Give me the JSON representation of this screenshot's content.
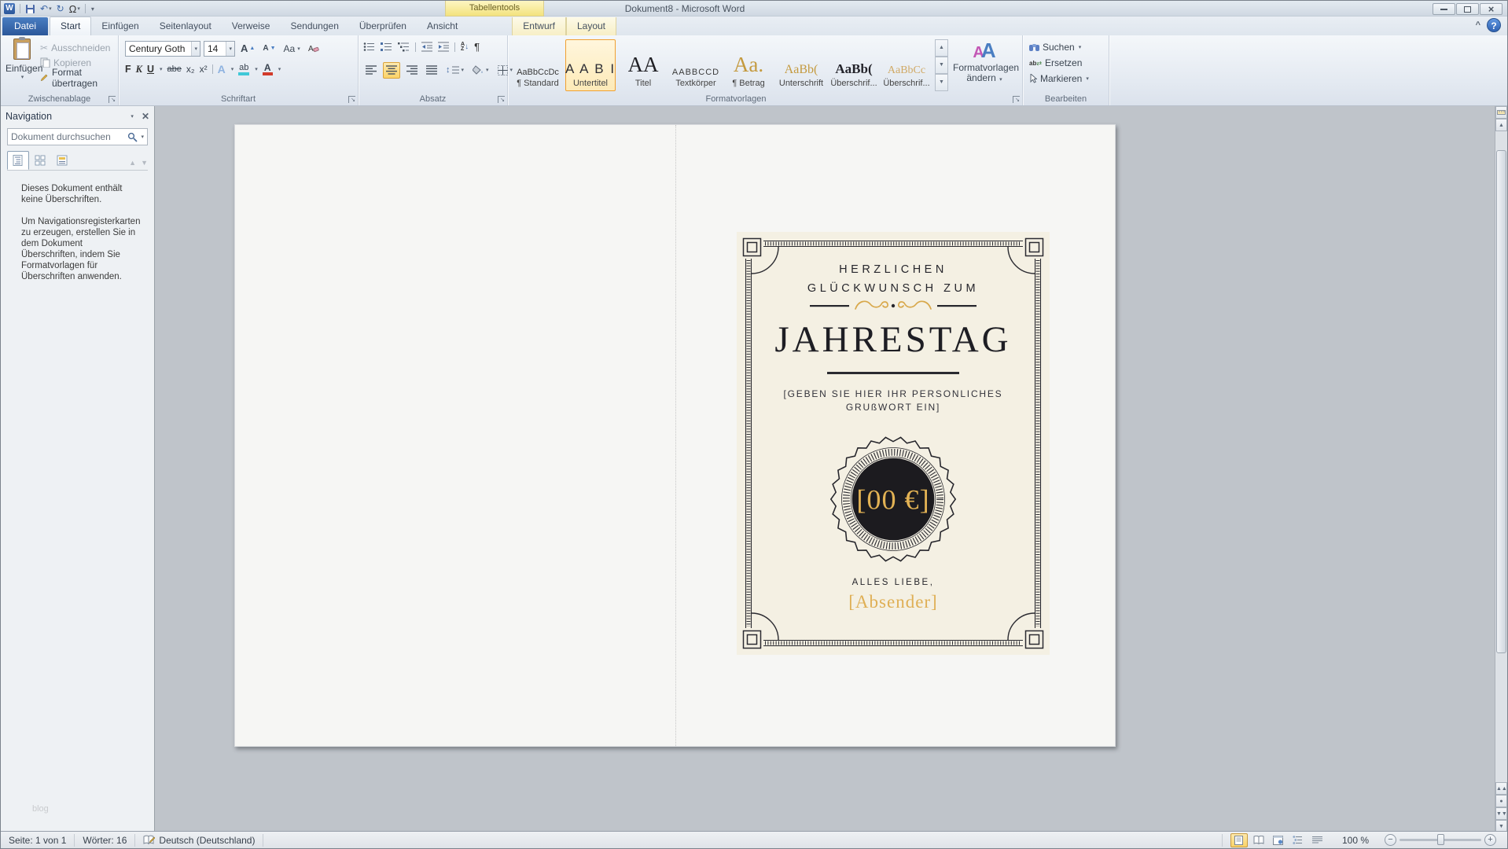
{
  "window": {
    "title": "Dokument8 - Microsoft Word",
    "contextual_tool": "Tabellentools"
  },
  "tabs": {
    "file": "Datei",
    "items": [
      "Start",
      "Einfügen",
      "Seitenlayout",
      "Verweise",
      "Sendungen",
      "Überprüfen",
      "Ansicht"
    ],
    "contextual": [
      "Entwurf",
      "Layout"
    ]
  },
  "ribbon": {
    "clipboard": {
      "label": "Zwischenablage",
      "paste": "Einfügen",
      "cut": "Ausschneiden",
      "copy": "Kopieren",
      "format_painter": "Format übertragen"
    },
    "font": {
      "label": "Schriftart",
      "name": "Century Goth",
      "size": "14",
      "bold": "F",
      "italic": "K",
      "underline": "U",
      "strike": "abe",
      "subscript": "x₂",
      "superscript": "x²",
      "case": "Aa",
      "effects": "A",
      "highlight": "ab",
      "color": "A"
    },
    "paragraph": {
      "label": "Absatz",
      "sort_a": "A",
      "sort_z": "Z",
      "pilcrow": "¶"
    },
    "styles": {
      "label": "Formatvorlagen",
      "change_line1": "Formatvorlagen",
      "change_line2": "ändern",
      "items": [
        {
          "preview": "AaBbCcDc",
          "label": "¶ Standard"
        },
        {
          "preview": "A A B I",
          "label": "Untertitel"
        },
        {
          "preview": "AA",
          "label": "Titel"
        },
        {
          "preview": "AABBCCD",
          "label": "Textkörper"
        },
        {
          "preview": "Aa.",
          "label": "¶ Betrag"
        },
        {
          "preview": "AaBb(",
          "label": "Unterschrift"
        },
        {
          "preview": "AaBb(",
          "label": "Überschrif..."
        },
        {
          "preview": "AaBbCc",
          "label": "Überschrif..."
        }
      ]
    },
    "editing": {
      "label": "Bearbeiten",
      "find": "Suchen",
      "replace": "Ersetzen",
      "select": "Markieren"
    }
  },
  "navigation_pane": {
    "title": "Navigation",
    "search_placeholder": "Dokument durchsuchen",
    "empty_message_1": "Dieses Dokument enthält keine Überschriften.",
    "empty_message_2": "Um Navigationsregisterkarten zu erzeugen, erstellen Sie in dem Dokument Überschriften, indem Sie Formatvorlagen für Überschriften anwenden.",
    "watermark": "blog"
  },
  "document": {
    "card": {
      "greeting_line1": "HERZLICHEN",
      "greeting_line2": "GLÜCKWUNSCH ZUM",
      "title": "JAHRESTAG",
      "placeholder_line1": "[GEBEN SIE HIER IHR PERSONLICHES",
      "placeholder_line2": "GRUßWORT EIN]",
      "amount": "[00 €]",
      "closing": "ALLES LIEBE,",
      "sender": "[Absender]"
    }
  },
  "statusbar": {
    "page": "Seite: 1 von 1",
    "words": "Wörter: 16",
    "language": "Deutsch (Deutschland)",
    "zoom": "100 %"
  },
  "colors": {
    "accent_gold": "#d8a84b",
    "card_background": "#f4f0e3",
    "seal_black": "#1c1b1f",
    "selection_orange": "#f0a030",
    "file_tab_blue": "#2b579a"
  }
}
